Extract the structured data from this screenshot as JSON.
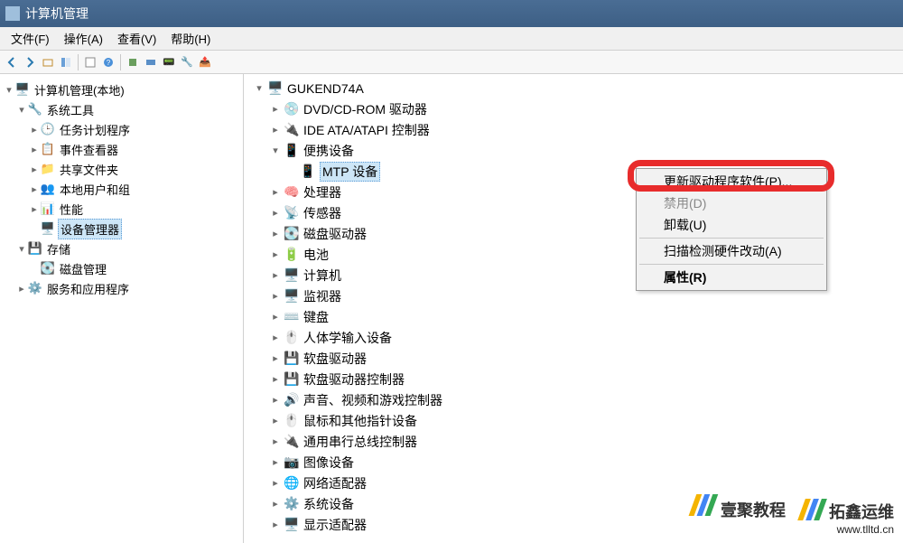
{
  "window": {
    "title": "计算机管理"
  },
  "menus": {
    "file": "文件(F)",
    "action": "操作(A)",
    "view": "查看(V)",
    "help": "帮助(H)"
  },
  "left_tree": {
    "root": "计算机管理(本地)",
    "sys_tools": "系统工具",
    "sys_children": [
      "任务计划程序",
      "事件查看器",
      "共享文件夹",
      "本地用户和组",
      "性能",
      "设备管理器"
    ],
    "storage": "存储",
    "storage_children": [
      "磁盘管理"
    ],
    "services": "服务和应用程序",
    "selected": "设备管理器"
  },
  "device_tree": {
    "root": "GUKEND74A",
    "items": [
      {
        "label": "DVD/CD-ROM 驱动器",
        "exp": ">"
      },
      {
        "label": "IDE ATA/ATAPI 控制器",
        "exp": ">"
      },
      {
        "label": "便携设备",
        "exp": "v",
        "children": [
          {
            "label": "MTP 设备",
            "selected": true
          }
        ]
      },
      {
        "label": "处理器",
        "exp": ">"
      },
      {
        "label": "传感器",
        "exp": ">"
      },
      {
        "label": "磁盘驱动器",
        "exp": ">"
      },
      {
        "label": "电池",
        "exp": ">"
      },
      {
        "label": "计算机",
        "exp": ">"
      },
      {
        "label": "监视器",
        "exp": ">"
      },
      {
        "label": "键盘",
        "exp": ">"
      },
      {
        "label": "人体学输入设备",
        "exp": ">"
      },
      {
        "label": "软盘驱动器",
        "exp": ">"
      },
      {
        "label": "软盘驱动器控制器",
        "exp": ">"
      },
      {
        "label": "声音、视频和游戏控制器",
        "exp": ">"
      },
      {
        "label": "鼠标和其他指针设备",
        "exp": ">"
      },
      {
        "label": "通用串行总线控制器",
        "exp": ">"
      },
      {
        "label": "图像设备",
        "exp": ">"
      },
      {
        "label": "网络适配器",
        "exp": ">"
      },
      {
        "label": "系统设备",
        "exp": ">"
      },
      {
        "label": "显示适配器",
        "exp": ">"
      }
    ]
  },
  "ctx": {
    "update": "更新驱动程序软件(P)...",
    "disable": "禁用(D)",
    "uninstall": "卸载(U)",
    "scan": "扫描检测硬件改动(A)",
    "properties": "属性(R)"
  },
  "watermarks": {
    "right_cn": "拓鑫运维",
    "right_url": "www.tlltd.cn",
    "left_cn": "壹聚教程"
  }
}
